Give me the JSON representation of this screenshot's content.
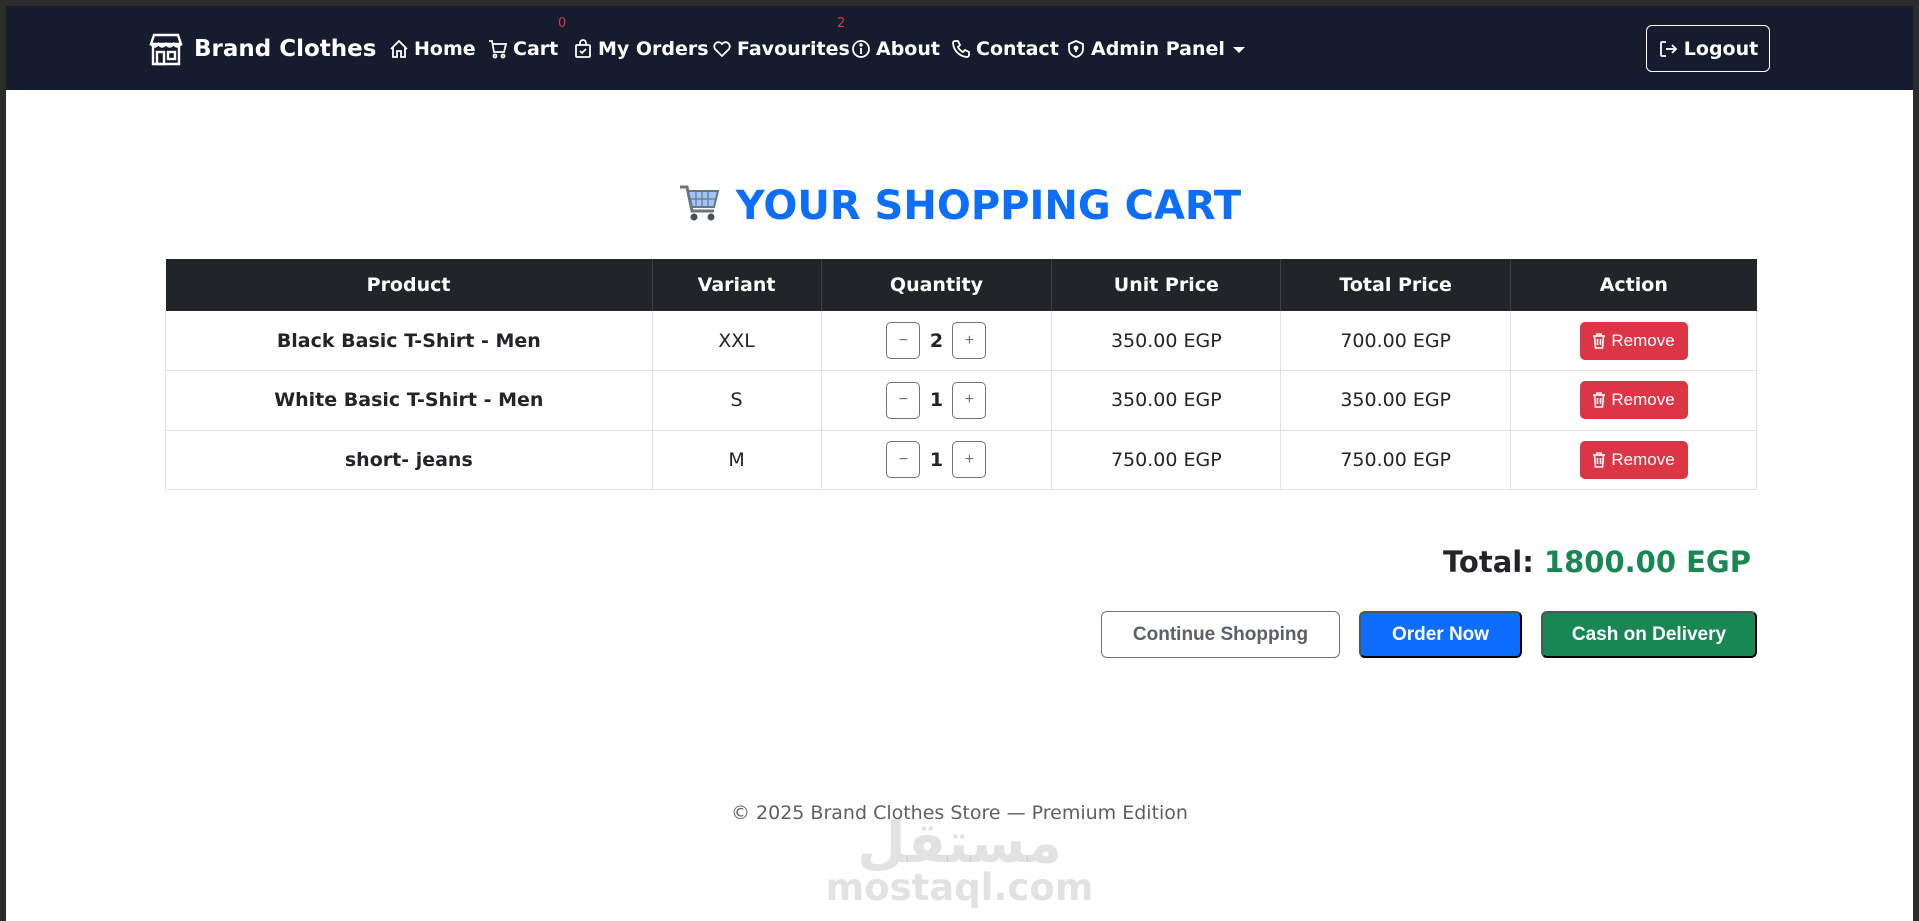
{
  "navbar": {
    "brand": "Brand Clothes",
    "items": [
      {
        "label": "Home"
      },
      {
        "label": "Cart",
        "badge": "0"
      },
      {
        "label": "My Orders"
      },
      {
        "label": "Favourites",
        "badge": "2"
      },
      {
        "label": "About"
      },
      {
        "label": "Contact"
      },
      {
        "label": "Admin Panel"
      }
    ],
    "logout": "Logout"
  },
  "page": {
    "title": "YOUR SHOPPING CART",
    "title_icon": "shopping-cart-emoji"
  },
  "table": {
    "headers": [
      "Product",
      "Variant",
      "Quantity",
      "Unit Price",
      "Total Price",
      "Action"
    ],
    "rows": [
      {
        "product": "Black Basic T-Shirt - Men",
        "variant": "XXL",
        "qty": "2",
        "unit_price": "350.00 EGP",
        "total_price": "700.00 EGP",
        "action": "Remove"
      },
      {
        "product": "White Basic T-Shirt - Men",
        "variant": "S",
        "qty": "1",
        "unit_price": "350.00 EGP",
        "total_price": "350.00 EGP",
        "action": "Remove"
      },
      {
        "product": "short- jeans",
        "variant": "M",
        "qty": "1",
        "unit_price": "750.00 EGP",
        "total_price": "750.00 EGP",
        "action": "Remove"
      }
    ],
    "qty_minus": "−",
    "qty_plus": "+"
  },
  "summary": {
    "total_label": "Total:",
    "total_value": "1800.00 EGP"
  },
  "actions": {
    "continue": "Continue Shopping",
    "order": "Order Now",
    "cod": "Cash on Delivery"
  },
  "footer": {
    "text": "© 2025 Brand Clothes Store — Premium Edition"
  },
  "watermark": {
    "arabic": "مستقل",
    "latin": "mostaql.com"
  },
  "colors": {
    "navbar_bg": "#141c2d",
    "primary": "#0d6efd",
    "success": "#198754",
    "danger": "#dc3545",
    "table_head": "#212529"
  }
}
